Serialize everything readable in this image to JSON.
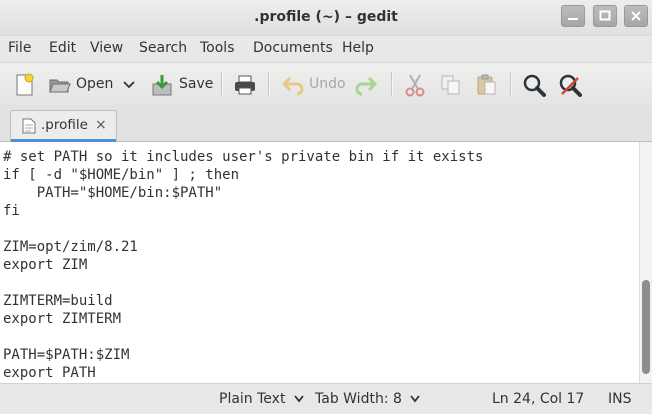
{
  "window": {
    "title": ".profile (~) – gedit"
  },
  "menubar": {
    "items": [
      "File",
      "Edit",
      "View",
      "Search",
      "Tools",
      "Documents",
      "Help"
    ]
  },
  "toolbar": {
    "open_label": "Open",
    "save_label": "Save",
    "undo_label": "Undo"
  },
  "tab": {
    "label": ".profile",
    "close_glyph": "×"
  },
  "editor": {
    "lines": [
      "# set PATH so it includes user's private bin if it exists",
      "if [ -d \"$HOME/bin\" ] ; then",
      "    PATH=\"$HOME/bin:$PATH\"",
      "fi",
      "",
      "ZIM=opt/zim/8.21",
      "export ZIM",
      "",
      "ZIMTERM=build",
      "export ZIMTERM",
      "",
      "PATH=$PATH:$ZIM",
      "export PATH"
    ]
  },
  "statusbar": {
    "language": "Plain Text",
    "tab_width": "Tab Width:  8",
    "position": "Ln 24, Col 17",
    "mode": "INS"
  },
  "colors": {
    "tab_accent": "#4a90d9",
    "background": "#e8e8e7"
  }
}
